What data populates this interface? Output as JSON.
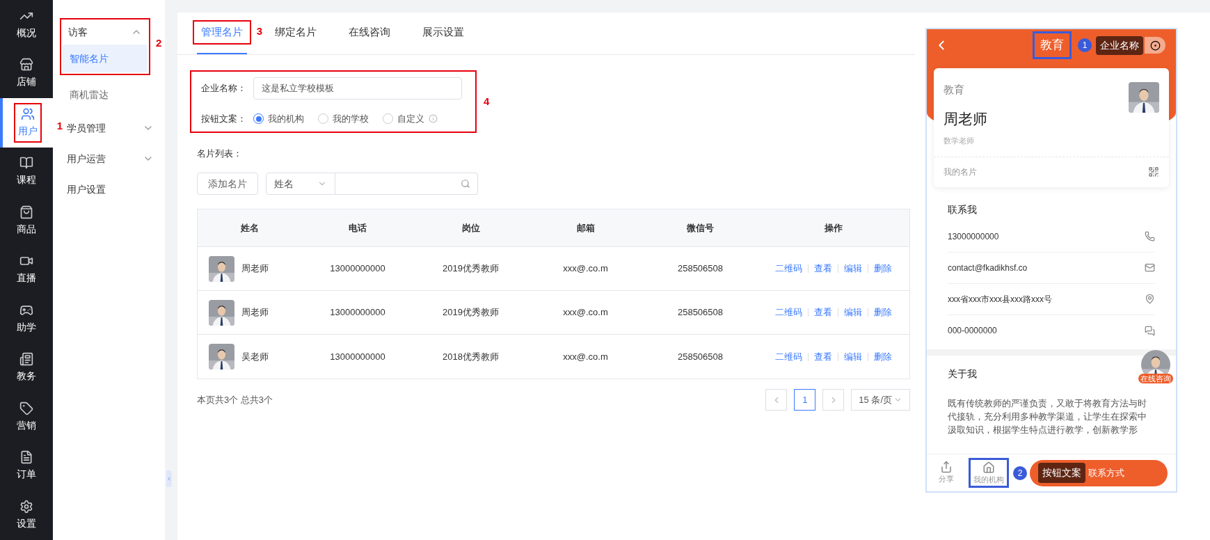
{
  "nav_rail": {
    "items": [
      {
        "label": "概况",
        "selected": false
      },
      {
        "label": "店铺",
        "selected": false
      },
      {
        "label": "用户",
        "selected": true,
        "annotation": "1"
      },
      {
        "label": "课程",
        "selected": false
      },
      {
        "label": "商品",
        "selected": false
      },
      {
        "label": "直播",
        "selected": false
      },
      {
        "label": "助学",
        "selected": false
      },
      {
        "label": "教务",
        "selected": false
      },
      {
        "label": "营销",
        "selected": false
      },
      {
        "label": "订单",
        "selected": false
      },
      {
        "label": "设置",
        "selected": false
      }
    ]
  },
  "menu": {
    "annotation": "2",
    "items": [
      {
        "label": "访客",
        "expanded": true,
        "children": [
          {
            "label": "智能名片",
            "selected": true
          },
          {
            "label": "商机雷达",
            "selected": false
          }
        ]
      },
      {
        "label": "学员管理",
        "expanded": false
      },
      {
        "label": "用户运营",
        "expanded": false
      },
      {
        "label": "用户设置"
      }
    ]
  },
  "tabs": [
    {
      "label": "管理名片",
      "selected": true,
      "annotation": "3"
    },
    {
      "label": "绑定名片",
      "selected": false
    },
    {
      "label": "在线咨询",
      "selected": false
    },
    {
      "label": "展示设置",
      "selected": false
    }
  ],
  "form": {
    "annotation": "4",
    "company_label": "企业名称：",
    "company_value": "这是私立学校模板",
    "button_text_label": "按钮文案：",
    "options": [
      {
        "label": "我的机构",
        "selected": true,
        "info": false
      },
      {
        "label": "我的学校",
        "selected": false,
        "info": false
      },
      {
        "label": "自定义",
        "selected": false,
        "info": true
      }
    ]
  },
  "list_label": "名片列表：",
  "toolbar": {
    "add_button": "添加名片",
    "filter": "姓名"
  },
  "table": {
    "columns": [
      "姓名",
      "电话",
      "岗位",
      "邮箱",
      "微信号",
      "操作"
    ],
    "rows": [
      {
        "name": "周老师",
        "phone": "13000000000",
        "position": "2019优秀教师",
        "email": "xxx@.co.m",
        "wechat": "258506508",
        "actions": [
          "二维码",
          "查看",
          "编辑",
          "删除"
        ]
      },
      {
        "name": "周老师",
        "phone": "13000000000",
        "position": "2019优秀教师",
        "email": "xxx@.co.m",
        "wechat": "258506508",
        "actions": [
          "二维码",
          "查看",
          "编辑",
          "删除"
        ]
      },
      {
        "name": "吴老师",
        "phone": "13000000000",
        "position": "2018优秀教师",
        "email": "xxx@.co.m",
        "wechat": "258506508",
        "actions": [
          "二维码",
          "查看",
          "编辑",
          "删除"
        ]
      }
    ]
  },
  "footer": {
    "summary": "本页共3个 总共3个",
    "pages": [
      {
        "label": "1",
        "selected": true
      }
    ],
    "page_size": "15 条/页"
  },
  "preview": {
    "title": "教育",
    "title_annotation": "1",
    "title_tooltip": "企业名称",
    "card": {
      "company": "教育",
      "name": "周老师",
      "role": "数学老师",
      "link": "我的名片"
    },
    "contact_heading": "联系我",
    "contacts": [
      "13000000000",
      "contact@fkadikhsf.co",
      "xxx省xxx市xxx县xxx路xxx号",
      "000-0000000"
    ],
    "about_heading": "关于我",
    "about_text": "既有传统教师的严谨负责，又敢于将教育方法与时代接轨，充分利用多种教学渠道，让学生在探索中汲取知识，根据学生特点进行教学，创新教学形",
    "consult_badge": "在线咨询",
    "bottom": {
      "share": "分享",
      "home": "我的机构",
      "home_annotation": "2",
      "tooltip": "按钮文案",
      "cta": "联系方式"
    }
  }
}
